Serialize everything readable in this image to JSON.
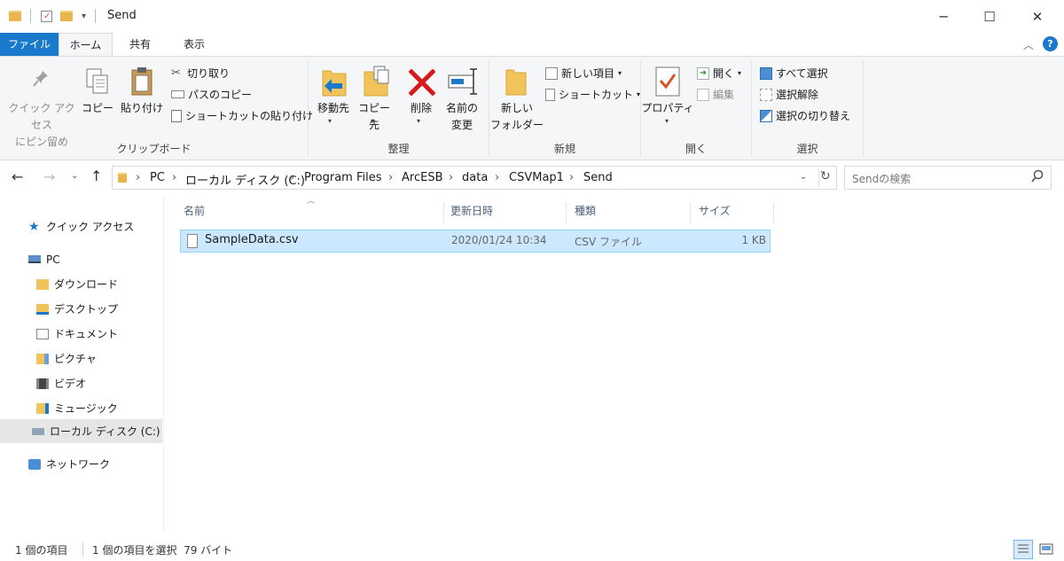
{
  "titlebar": {
    "title": "Send",
    "minimize": "─",
    "maximize": "☐",
    "close": "✕",
    "qat_dropdown": "▾"
  },
  "tabs": [
    {
      "label": "ファイル"
    },
    {
      "label": "ホーム"
    },
    {
      "label": "共有"
    },
    {
      "label": "表示"
    }
  ],
  "ribbon": {
    "clipboard": {
      "pin_quick_access_line1": "クイック アクセス",
      "pin_quick_access_line2": "にピン留め",
      "copy": "コピー",
      "paste": "貼り付け",
      "cut": "切り取り",
      "copy_path": "パスのコピー",
      "paste_shortcut": "ショートカットの貼り付け",
      "group": "クリップボード"
    },
    "organize": {
      "move_to": "移動先",
      "copy_to": "コピー先",
      "delete": "削除",
      "rename_line1": "名前の",
      "rename_line2": "変更",
      "group": "整理"
    },
    "new": {
      "new_folder_line1": "新しい",
      "new_folder_line2": "フォルダー",
      "new_item": "新しい項目",
      "shortcut": "ショートカット",
      "group": "新規"
    },
    "open": {
      "properties": "プロパティ",
      "open": "開く",
      "edit": "編集",
      "group": "開く"
    },
    "select": {
      "select_all": "すべて選択",
      "select_none": "選択解除",
      "invert": "選択の切り替え",
      "group": "選択"
    }
  },
  "address": {
    "crumbs": [
      "PC",
      "ローカル ディスク (C:)",
      "Program Files",
      "ArcESB",
      "data",
      "CSVMap1",
      "Send"
    ]
  },
  "search": {
    "placeholder": "Sendの検索"
  },
  "nav": {
    "quick_access": "クイック アクセス",
    "pc": "PC",
    "downloads": "ダウンロード",
    "desktop": "デスクトップ",
    "documents": "ドキュメント",
    "pictures": "ピクチャ",
    "videos": "ビデオ",
    "music": "ミュージック",
    "local_disk": "ローカル ディスク (C:)",
    "network": "ネットワーク"
  },
  "columns": {
    "name": "名前",
    "date": "更新日時",
    "type": "種類",
    "size": "サイズ"
  },
  "files": [
    {
      "name": "SampleData.csv",
      "date": "2020/01/24 10:34",
      "type": "CSV ファイル",
      "size": "1 KB"
    }
  ],
  "status": {
    "count": "1 個の項目",
    "selected": "1 個の項目を選択  79 バイト"
  },
  "colors": {
    "accent": "#1979ca",
    "selection": "#cce8ff",
    "selection_border": "#99d1ff"
  }
}
